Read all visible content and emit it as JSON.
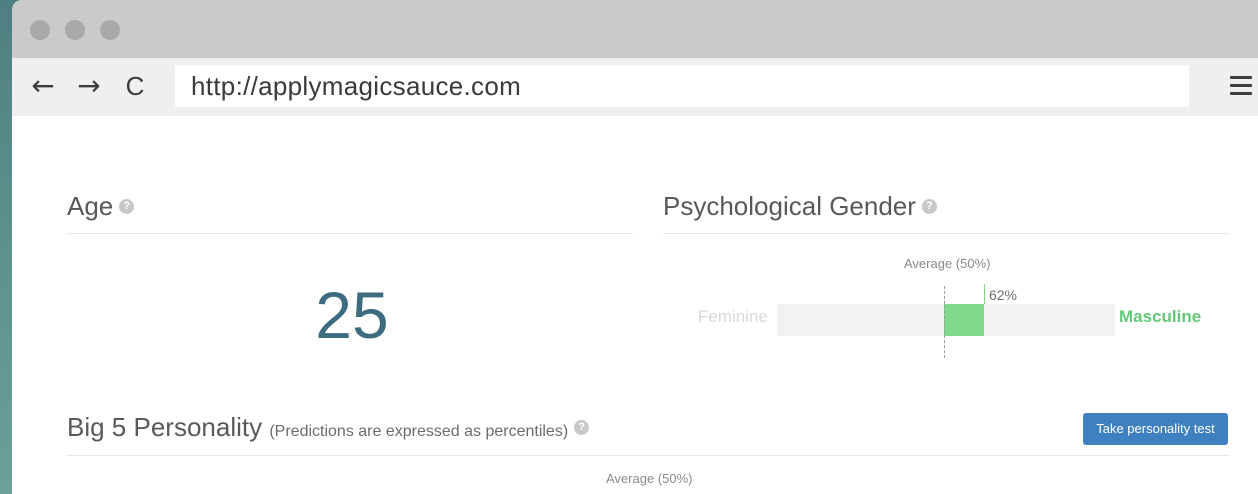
{
  "browser": {
    "url": "http://applymagicsauce.com",
    "back_icon": "←",
    "forward_icon": "→",
    "reload_icon": "C"
  },
  "age": {
    "title": "Age",
    "value": "25"
  },
  "gender": {
    "title": "Psychological Gender",
    "average_label": "Average (50%)",
    "left_label": "Feminine",
    "right_label": "Masculine",
    "percent_label": "62%",
    "percent_value": 62,
    "fill_color": "#7fd98c"
  },
  "big5": {
    "title": "Big 5 Personality",
    "subtitle": "(Predictions are expressed as percentiles)",
    "button_label": "Take personality test",
    "average_label": "Average (50%)"
  },
  "colors": {
    "accent_blue": "#3f80c0",
    "age_value": "#3d6b7f",
    "masculine_green": "#63c777"
  },
  "help_icon_glyph": "?"
}
